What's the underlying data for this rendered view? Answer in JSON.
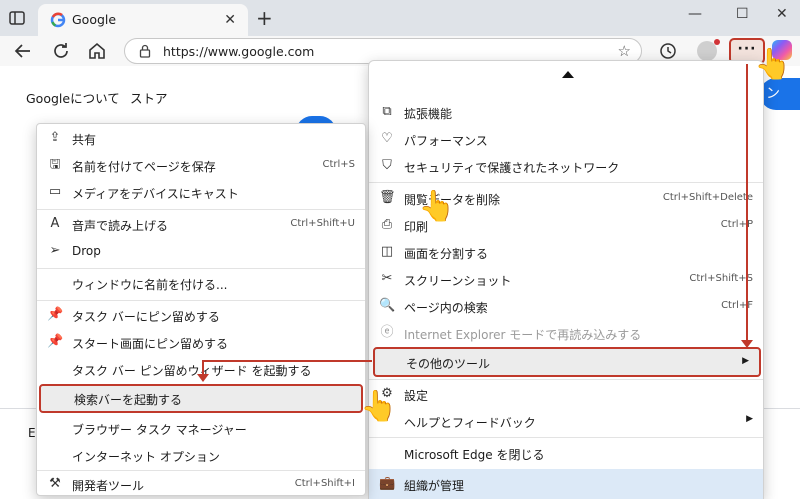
{
  "tab": {
    "title": "Google"
  },
  "address": {
    "url": "https://www.google.com"
  },
  "page": {
    "links": [
      "Googleについて",
      "ストア"
    ],
    "signin_partial": "ン",
    "footer_partial": "E"
  },
  "main_menu": {
    "items": [
      {
        "label": "拡張機能",
        "icon": "puzzle-icon",
        "shortcut": ""
      },
      {
        "label": "パフォーマンス",
        "icon": "heart-pulse-icon",
        "shortcut": ""
      },
      {
        "label": "セキュリティで保護されたネットワーク",
        "icon": "shield-icon",
        "shortcut": ""
      },
      {
        "label": "閲覧データを削除",
        "icon": "trash-icon",
        "shortcut": "Ctrl+Shift+Delete"
      },
      {
        "label": "印刷",
        "icon": "printer-icon",
        "shortcut": "Ctrl+P"
      },
      {
        "label": "画面を分割する",
        "icon": "split-screen-icon",
        "shortcut": ""
      },
      {
        "label": "スクリーンショット",
        "icon": "screenshot-icon",
        "shortcut": "Ctrl+Shift+S"
      },
      {
        "label": "ページ内の検索",
        "icon": "find-in-page-icon",
        "shortcut": "Ctrl+F"
      },
      {
        "label": "Internet Explorer モードで再読み込みする",
        "icon": "ie-mode-icon",
        "shortcut": ""
      },
      {
        "label": "その他のツール",
        "icon": "",
        "shortcut": ""
      },
      {
        "label": "設定",
        "icon": "gear-icon",
        "shortcut": ""
      },
      {
        "label": "ヘルプとフィードバック",
        "icon": "",
        "shortcut": ""
      },
      {
        "label": "Microsoft Edge を閉じる",
        "icon": "",
        "shortcut": ""
      },
      {
        "label": "組織が管理",
        "icon": "briefcase-icon",
        "shortcut": ""
      }
    ]
  },
  "sub_menu": {
    "items": [
      {
        "label": "共有",
        "icon": "share-icon",
        "shortcut": ""
      },
      {
        "label": "名前を付けてページを保存",
        "icon": "save-icon",
        "shortcut": "Ctrl+S"
      },
      {
        "label": "メディアをデバイスにキャスト",
        "icon": "cast-icon",
        "shortcut": ""
      },
      {
        "label": "音声で読み上げる",
        "icon": "read-aloud-icon",
        "shortcut": "Ctrl+Shift+U"
      },
      {
        "label": "Drop",
        "icon": "send-icon",
        "shortcut": ""
      },
      {
        "label": "ウィンドウに名前を付ける...",
        "icon": "",
        "shortcut": ""
      },
      {
        "label": "タスク バーにピン留めする",
        "icon": "pin-icon",
        "shortcut": ""
      },
      {
        "label": "スタート画面にピン留めする",
        "icon": "pin-icon",
        "shortcut": ""
      },
      {
        "label": "タスク バー ピン留めウィザード を起動する",
        "icon": "",
        "shortcut": ""
      },
      {
        "label": "検索バーを起動する",
        "icon": "",
        "shortcut": ""
      },
      {
        "label": "ブラウザー タスク マネージャー",
        "icon": "",
        "shortcut": ""
      },
      {
        "label": "インターネット オプション",
        "icon": "",
        "shortcut": ""
      },
      {
        "label": "開発者ツール",
        "icon": "devtools-icon",
        "shortcut": "Ctrl+Shift+I"
      }
    ]
  },
  "colors": {
    "annotation": "#c0392b",
    "accent": "#1a73e8"
  }
}
